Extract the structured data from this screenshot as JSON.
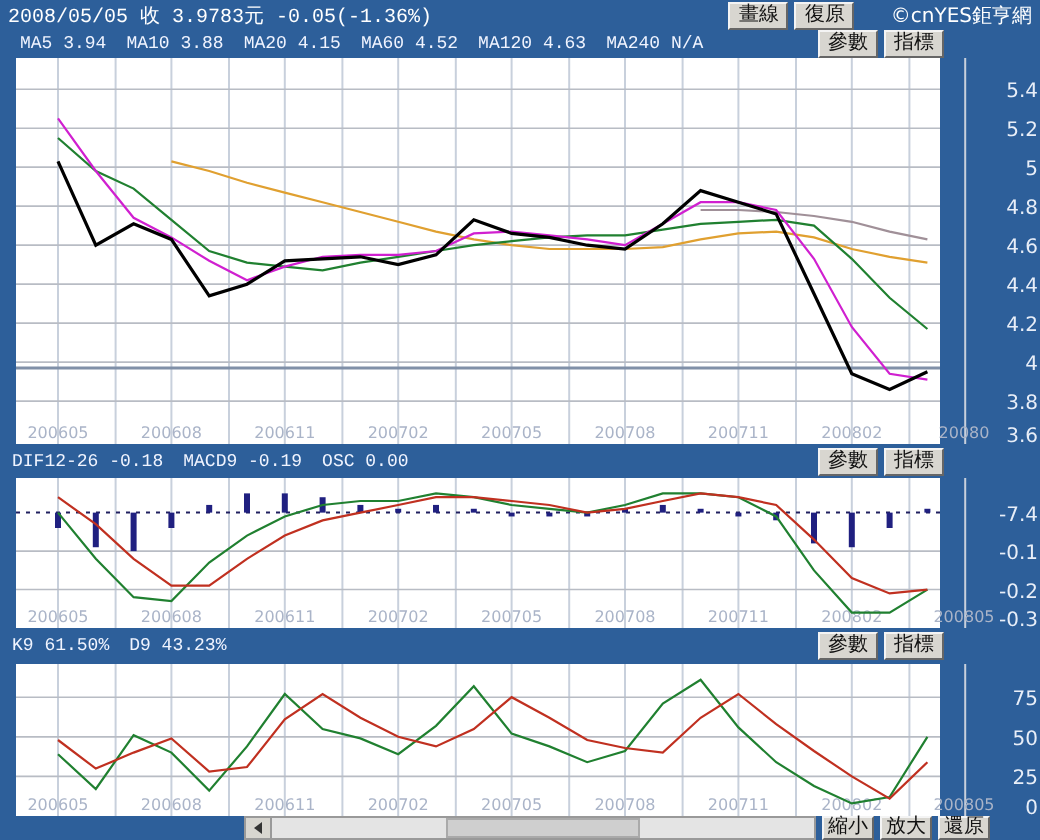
{
  "top": {
    "title": "2008/05/05 收 3.9783元 -0.05(-1.36%)",
    "buttons": [
      "畫線",
      "復原"
    ],
    "copyright": "©cnYES鉅亨網"
  },
  "panels": [
    {
      "legend": [
        "MA5 3.94",
        "MA10 3.88",
        "MA20 4.15",
        "MA60 4.52",
        "MA120 4.63",
        "MA240 N/A"
      ],
      "buttons": [
        "參數",
        "指標"
      ],
      "chart_data": {
        "type": "line",
        "grid": true,
        "categories": [
          "200605",
          null,
          null,
          "200608",
          null,
          null,
          "200611",
          null,
          null,
          "200702",
          null,
          null,
          "200705",
          null,
          null,
          "200708",
          null,
          null,
          "200711",
          null,
          null,
          "200802",
          null,
          null,
          "20080"
        ],
        "ylim": [
          3.58,
          5.56
        ],
        "yticks": [
          3.6,
          3.8,
          4.0,
          4.2,
          4.4,
          4.6,
          4.8,
          5.0,
          5.2,
          5.4
        ],
        "ref_lines": [
          {
            "axis": "y",
            "value": 3.97
          }
        ],
        "series": [
          {
            "color": "#a09098",
            "values": [
              null,
              null,
              null,
              null,
              null,
              null,
              null,
              null,
              null,
              null,
              null,
              null,
              null,
              null,
              null,
              null,
              null,
              4.78,
              4.78,
              4.77,
              4.75,
              4.72,
              4.67,
              4.63,
              null
            ]
          },
          {
            "color": "#e0a030",
            "values": [
              null,
              null,
              null,
              5.03,
              4.98,
              4.92,
              4.87,
              4.82,
              4.77,
              4.72,
              4.67,
              4.63,
              4.6,
              4.58,
              4.58,
              4.58,
              4.59,
              4.63,
              4.66,
              4.67,
              4.64,
              4.58,
              4.54,
              4.51,
              null
            ]
          },
          {
            "color": "#208030",
            "values": [
              5.15,
              4.98,
              4.89,
              4.73,
              4.57,
              4.51,
              4.49,
              4.47,
              4.51,
              4.54,
              4.57,
              4.6,
              4.62,
              4.64,
              4.65,
              4.65,
              4.68,
              4.71,
              4.72,
              4.73,
              4.7,
              4.53,
              4.33,
              4.17,
              null
            ]
          },
          {
            "color": "#d020d0",
            "values": [
              5.25,
              4.98,
              4.74,
              4.64,
              4.52,
              4.42,
              4.49,
              4.54,
              4.55,
              4.55,
              4.57,
              4.66,
              4.67,
              4.65,
              4.63,
              4.6,
              4.71,
              4.82,
              4.82,
              4.78,
              4.53,
              4.18,
              3.94,
              3.91,
              null
            ]
          },
          {
            "color": "#000000",
            "values": [
              5.03,
              4.6,
              4.71,
              4.63,
              4.34,
              4.4,
              4.52,
              4.53,
              4.54,
              4.5,
              4.55,
              4.73,
              4.66,
              4.64,
              4.6,
              4.58,
              4.71,
              4.88,
              4.82,
              4.76,
              4.35,
              3.94,
              3.86,
              3.95,
              null
            ]
          }
        ]
      }
    },
    {
      "legend": [
        "DIF12-26 -0.18",
        "MACD9 -0.19",
        "OSC 0.00"
      ],
      "buttons": [
        "參數",
        "指標"
      ],
      "zero_label": "-7.4",
      "chart_data": {
        "type": "line",
        "grid": true,
        "categories": [
          "200605",
          null,
          null,
          "200608",
          null,
          null,
          "200611",
          null,
          null,
          "200702",
          null,
          null,
          "200705",
          null,
          null,
          "200708",
          null,
          null,
          "200711",
          null,
          null,
          "200802",
          null,
          null,
          "200805"
        ],
        "ylim": [
          -0.3,
          0.09
        ],
        "yticks": [
          -0.1,
          -0.2,
          -0.3
        ],
        "ref_lines": [
          {
            "axis": "y",
            "value": 0
          }
        ],
        "series": [
          {
            "type": "bar",
            "color": "#202080",
            "values": [
              -0.04,
              -0.09,
              -0.1,
              -0.04,
              0.02,
              0.05,
              0.05,
              0.04,
              0.02,
              0.01,
              0.02,
              0.01,
              -0.01,
              -0.01,
              -0.01,
              0.01,
              0.02,
              0.01,
              -0.01,
              -0.02,
              -0.08,
              -0.09,
              -0.04,
              0.01,
              null
            ]
          },
          {
            "color": "#208030",
            "values": [
              0,
              -0.12,
              -0.22,
              -0.23,
              -0.13,
              -0.06,
              -0.01,
              0.02,
              0.03,
              0.03,
              0.05,
              0.04,
              0.02,
              0.01,
              0,
              0.02,
              0.05,
              0.05,
              0.04,
              -0.01,
              -0.15,
              -0.26,
              -0.26,
              -0.2,
              null
            ]
          },
          {
            "color": "#c03020",
            "values": [
              0.04,
              -0.03,
              -0.12,
              -0.19,
              -0.19,
              -0.12,
              -0.06,
              -0.02,
              0,
              0.02,
              0.04,
              0.04,
              0.03,
              0.02,
              0,
              0.01,
              0.03,
              0.05,
              0.04,
              0.02,
              -0.07,
              -0.17,
              -0.21,
              -0.2,
              null
            ]
          }
        ]
      }
    },
    {
      "legend": [
        "K9 61.50%",
        "D9 43.23%"
      ],
      "buttons": [
        "參數",
        "指標"
      ],
      "chart_data": {
        "type": "line",
        "grid": true,
        "categories": [
          "200605",
          null,
          null,
          "200608",
          null,
          null,
          "200611",
          null,
          null,
          "200702",
          null,
          null,
          "200705",
          null,
          null,
          "200708",
          null,
          null,
          "200711",
          null,
          null,
          "200802",
          null,
          null,
          "200805"
        ],
        "ylim": [
          0,
          96
        ],
        "yticks": [
          0,
          25,
          50,
          75
        ],
        "series": [
          {
            "color": "#208030",
            "values": [
              39,
              17,
              51,
              40,
              16,
              44,
              77,
              55,
              49,
              39,
              57,
              82,
              52,
              44,
              34,
              41,
              71,
              86,
              56,
              34,
              19,
              8,
              12,
              50,
              null
            ]
          },
          {
            "color": "#c03020",
            "values": [
              48,
              30,
              40,
              49,
              28,
              31,
              61,
              77,
              62,
              50,
              44,
              55,
              75,
              62,
              48,
              43,
              40,
              62,
              77,
              58,
              41,
              25,
              11,
              34,
              null
            ]
          }
        ]
      }
    }
  ],
  "bottom": {
    "buttons": [
      "縮小",
      "放大",
      "還原"
    ]
  }
}
